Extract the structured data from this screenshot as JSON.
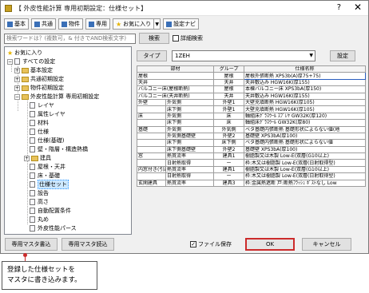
{
  "window": {
    "title": "【 外皮性能計算 専用初期設定：仕様セット】",
    "help": "?",
    "close": "✕"
  },
  "toolbar": [
    {
      "name": "tab-basic",
      "label": "基本"
    },
    {
      "name": "tab-common",
      "label": "共通"
    },
    {
      "name": "tab-property",
      "label": "物件"
    },
    {
      "name": "tab-dedicated",
      "label": "専用"
    },
    {
      "name": "tab-favorites",
      "label": "お気に入り"
    },
    {
      "name": "tab-setting-navi",
      "label": "設定ナビ"
    }
  ],
  "search": {
    "placeholder": "検索ワードは？(複数可，& 付きでAND検索文字)",
    "button": "検索",
    "detail_label": "詳細検索"
  },
  "tree": {
    "favorites": "お気に入り",
    "all_settings": "すべての設定",
    "items": [
      "基本設定",
      "共通初期設定",
      "物件初期設定",
      "外皮性能計算 専用初期設定",
      "レイヤ",
      "属性レイヤ",
      "材料",
      "仕様",
      "仕様(基礎)",
      "壁・階層・構造熱橋",
      "建具",
      "屋根・天井",
      "床・基礎",
      "仕様セット",
      "設告",
      "高さ",
      "自動配置条件",
      "丸め",
      "外皮性能パース"
    ]
  },
  "type_row": {
    "button": "タイプ",
    "selected": "1ZEH",
    "settings_button": "設定"
  },
  "table": {
    "headers": [
      "部材",
      "グループ",
      "仕様名称"
    ],
    "rows": [
      [
        "屋根",
        "",
        "屋根",
        "屋根外張断熱 XPS3b(A)厚75+75)"
      ],
      [
        "天井",
        "",
        "天井",
        "天井敷込み HGW16K(厚155)"
      ],
      [
        "バルコニー床(屋根断熱)",
        "",
        "屋根",
        "本棟バルコニー床 XPS3bA(厚150)"
      ],
      [
        "バルコニー床(天井断熱)",
        "",
        "天井",
        "天井敷込み HGW16K(厚155)"
      ],
      [
        "外壁",
        "外気側",
        "外壁1",
        "大壁充填断熱 HGW16K(厚105)"
      ],
      [
        "",
        "床下側",
        "外壁1",
        "大壁充填断熱 HGW16K(厚105)"
      ],
      [
        "床",
        "外気側",
        "床",
        "軸組床ｸﾞﾗｽｳｰﾙ ｽﾌﾟﾚﾔ GW32K(厚120)"
      ],
      [
        "",
        "床下側",
        "床",
        "軸組床ｸﾞﾗｽｳｰﾙ GW32K(厚80)"
      ],
      [
        "基礎",
        "外気側",
        "外気側",
        "ベタ基礎内張断熱 基礎形状によらない値(地"
      ],
      [
        "",
        "外気側基礎壁",
        "外壁2",
        "基礎壁 XPS3bA(厚100)"
      ],
      [
        "",
        "床下側",
        "床下側",
        "ベタ基礎内張断熱 基礎形状によらない値"
      ],
      [
        "",
        "床下側基礎壁",
        "外壁2",
        "基礎壁 XPS3bA(厚100)"
      ],
      [
        "窓",
        "熱貫流率",
        "建具1",
        "樹脂製又は木製 Low-E(双層(G10以上)"
      ],
      [
        "",
        "日射熱取得",
        "ー",
        "枠:木又は樹脂製 Low-E(双層(日射取得型)"
      ],
      [
        "内窓付き(引違い)",
        "熱貫流率",
        "建具1",
        "樹脂製又は木製 Low-E(双層(G10以上)"
      ],
      [
        "",
        "日射熱取得",
        "ー",
        "枠:木又は樹脂製 Low-E(双層(日射取得型)"
      ],
      [
        "玄関建具",
        "熱貫流率",
        "建具3",
        "枠:金属熱遮断 戸:断熱ﾌﾗｯｼｭ ﾎﾟｽﾄなし Low"
      ]
    ]
  },
  "bottom": {
    "write_button": "専用マスタ書込",
    "read_button": "専用マスタ読込",
    "file_save_label": "ファイル保存",
    "ok_button": "OK",
    "cancel_button": "キャンセル"
  },
  "annotation": {
    "line1": "登録した仕様セットを",
    "line2": "マスタに書き込みます。"
  },
  "colors": {
    "accent": "#cc2b2b",
    "selection": "#cce8ff",
    "folder": "#e8c25a"
  }
}
